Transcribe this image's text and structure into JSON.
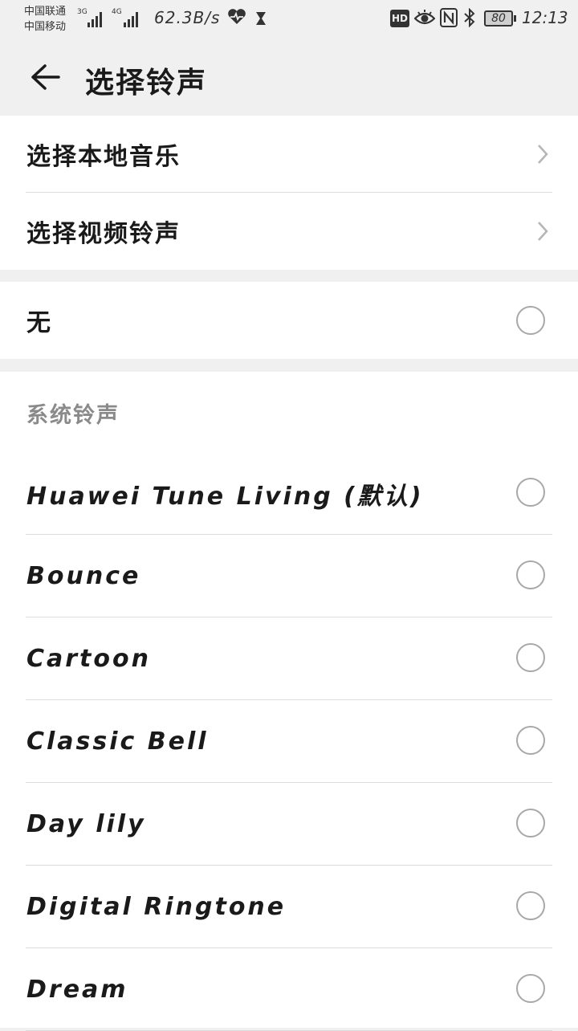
{
  "status_bar": {
    "carrier1": "中国联通",
    "carrier2": "中国移动",
    "net1": "3G",
    "net2": "4G",
    "speed": "62.3B/s",
    "battery": "80",
    "time": "12:13",
    "icons": [
      "heart-rate-icon",
      "hourglass-icon",
      "hd-icon",
      "eye-icon",
      "nfc-icon",
      "bluetooth-icon",
      "battery-icon"
    ]
  },
  "toolbar": {
    "title": "选择铃声",
    "back_icon": "arrow-left-icon"
  },
  "sources": [
    {
      "label": "选择本地音乐"
    },
    {
      "label": "选择视频铃声"
    }
  ],
  "none_option": {
    "label": "无",
    "selected": false
  },
  "system_section": {
    "header": "系统铃声",
    "ringtones": [
      {
        "label": "Huawei Tune Living (默认)",
        "selected": false
      },
      {
        "label": "Bounce",
        "selected": false
      },
      {
        "label": "Cartoon",
        "selected": false
      },
      {
        "label": "Classic Bell",
        "selected": false
      },
      {
        "label": "Day lily",
        "selected": false
      },
      {
        "label": "Digital Ringtone",
        "selected": false
      },
      {
        "label": "Dream",
        "selected": false
      }
    ]
  },
  "colors": {
    "background": "#f0f0f0",
    "card": "#ffffff",
    "divider": "#dcdcdc",
    "radio_border": "#a8a8a8",
    "section_header": "#8a8a8a"
  }
}
